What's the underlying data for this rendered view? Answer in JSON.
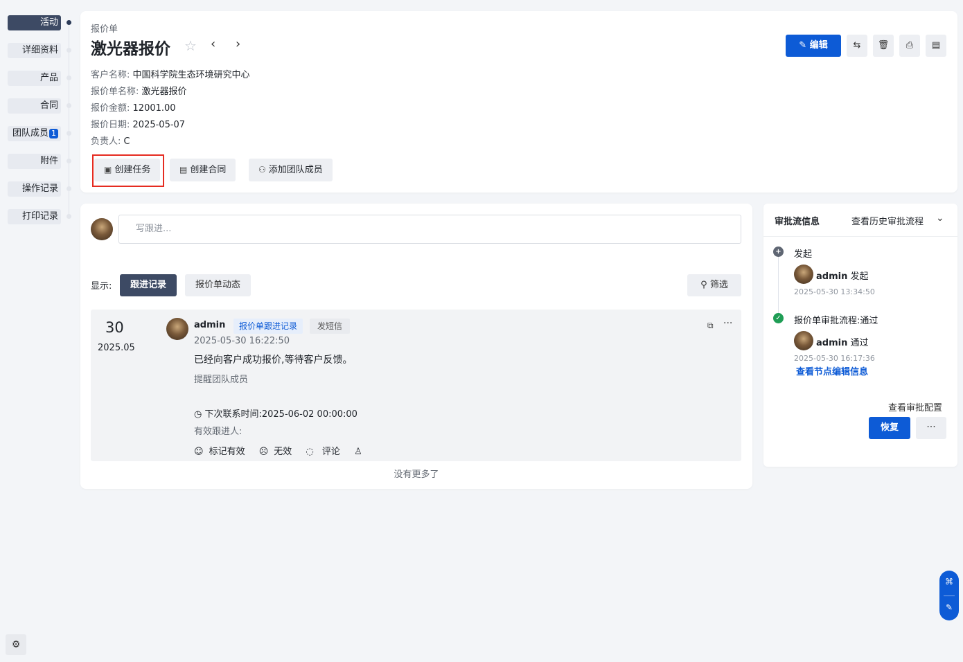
{
  "nav": {
    "items": [
      {
        "label": "活动"
      },
      {
        "label": "详细资料"
      },
      {
        "label": "产品"
      },
      {
        "label": "合同"
      },
      {
        "label": "团队成员",
        "badge": "1"
      },
      {
        "label": "附件"
      },
      {
        "label": "操作记录"
      },
      {
        "label": "打印记录"
      }
    ]
  },
  "header": {
    "breadcrumb": "报价单",
    "title": "激光器报价",
    "edit_label": "编辑",
    "fields": [
      {
        "label": "客户名称:",
        "value": "中国科学院生态环境研究中心"
      },
      {
        "label": "报价单名称:",
        "value": "激光器报价"
      },
      {
        "label": "报价金额:",
        "value": "12001.00"
      },
      {
        "label": "报价日期:",
        "value": "2025-05-07"
      },
      {
        "label": "负责人:",
        "value": "C"
      }
    ],
    "actions": [
      {
        "label": "创建任务"
      },
      {
        "label": "创建合同"
      },
      {
        "label": "添加团队成员"
      }
    ]
  },
  "activity": {
    "write_placeholder": "写跟进...",
    "show_label": "显示:",
    "tabs": [
      {
        "label": "跟进记录"
      },
      {
        "label": "报价单动态"
      }
    ],
    "filter_label": "筛选",
    "record": {
      "day": "30",
      "year_month": "2025.05",
      "user": "admin",
      "tag": "报价单跟进记录",
      "sms": "发短信",
      "time": "2025-05-30 16:22:50",
      "content": "已经向客户成功报价,等待客户反馈。",
      "remind": "提醒团队成员",
      "next_contact": "下次联系时间:2025-06-02 00:00:00",
      "valid_follower": "有效跟进人:",
      "mark_valid": "标记有效",
      "invalid": "无效",
      "comment": "评论"
    },
    "no_more": "没有更多了"
  },
  "approval": {
    "title": "审批流信息",
    "history": "查看历史审批流程",
    "steps": [
      {
        "title": "发起",
        "user": "admin",
        "action": "发起",
        "time": "2025-05-30 13:34:50"
      },
      {
        "title": "报价单审批流程:通过",
        "user": "admin",
        "action": "通过",
        "time": "2025-05-30 16:17:36"
      }
    ],
    "node_link": "查看节点编辑信息",
    "config": "查看审批配置",
    "restore": "恢复"
  }
}
